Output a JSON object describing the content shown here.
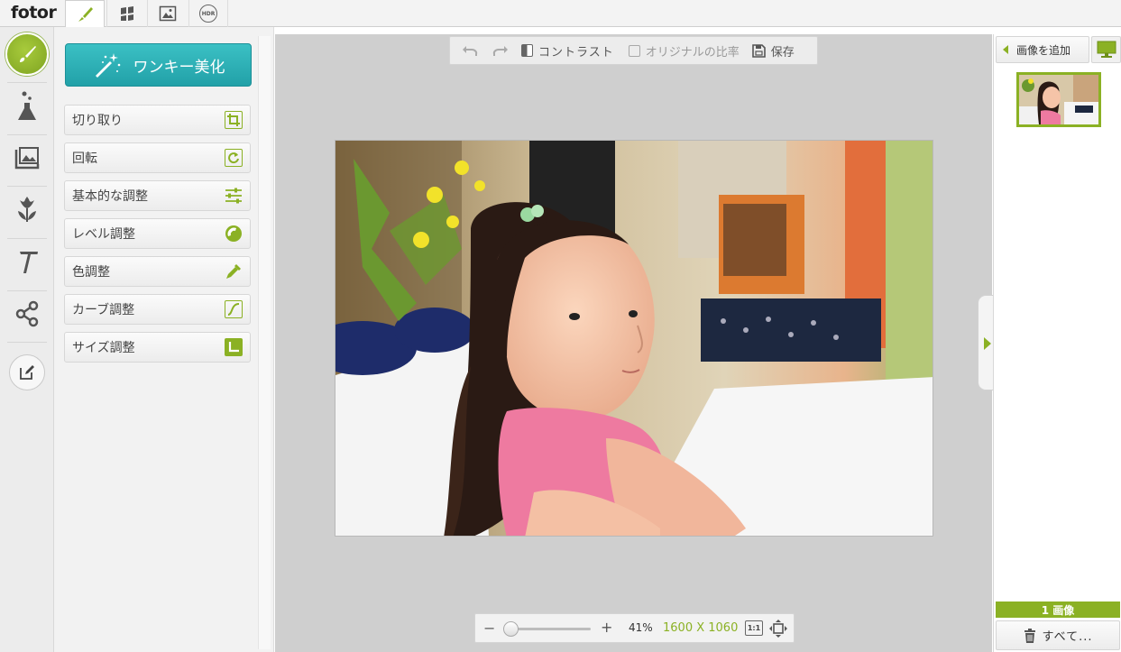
{
  "app": {
    "logo": "fotor"
  },
  "tabs": [
    {
      "name": "edit-brush-icon",
      "active": true
    },
    {
      "name": "collage-icon",
      "active": false
    },
    {
      "name": "image-icon",
      "active": false
    },
    {
      "name": "hdr-icon",
      "label": "HDR",
      "active": false
    }
  ],
  "iconbar": [
    "brush-icon",
    "flask-icon",
    "frame-icon",
    "tulip-icon",
    "text-icon",
    "share-icon",
    "edit-note-icon"
  ],
  "tools": {
    "onekey_label": "ワンキー美化",
    "items": [
      {
        "label": "切り取り",
        "icon": "crop-icon"
      },
      {
        "label": "回転",
        "icon": "rotate-icon"
      },
      {
        "label": "基本的な調整",
        "icon": "sliders-icon"
      },
      {
        "label": "レベル調整",
        "icon": "level-icon"
      },
      {
        "label": "色調整",
        "icon": "dropper-icon"
      },
      {
        "label": "カーブ調整",
        "icon": "curve-icon"
      },
      {
        "label": "サイズ調整",
        "icon": "resize-icon"
      }
    ]
  },
  "canvas_toolbar": {
    "contrast_label": "コントラスト",
    "original_ratio_label": "オリジナルの比率",
    "save_label": "保存"
  },
  "zoom": {
    "minus": "−",
    "plus": "+",
    "percent": "41%",
    "dimensions": "1600 X 1060",
    "one_to_one": "1:1",
    "level": 0.05
  },
  "right_panel": {
    "add_image_label": "画像を追加",
    "count_label": "1 画像",
    "all_label": "すべて..."
  },
  "colors": {
    "accent": "#8bb124",
    "teal": "#2bb0b6"
  }
}
